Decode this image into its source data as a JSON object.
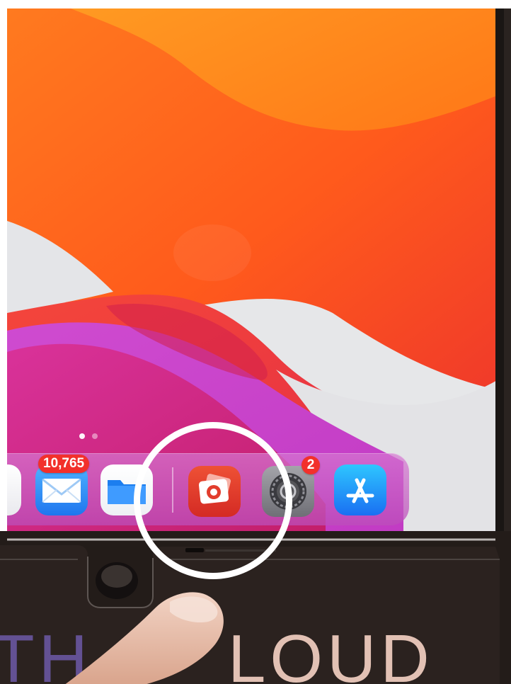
{
  "home_screen": {
    "page_indicator": {
      "pages": 2,
      "current": 1
    }
  },
  "dock": {
    "apps": [
      {
        "id": "partial-app",
        "icon": "app-icon-partial"
      },
      {
        "id": "mail",
        "icon": "envelope-icon",
        "badge": "10,765",
        "color": "#2d8ff5"
      },
      {
        "id": "files",
        "icon": "folder-icon",
        "color": "#1a82f0"
      },
      {
        "id": "photo-editor",
        "icon": "camera-photos-icon",
        "color": "#e63a2f"
      },
      {
        "id": "settings",
        "icon": "gear-icon",
        "badge": "2",
        "color": "#8e8e93"
      },
      {
        "id": "app-store",
        "icon": "app-store-icon",
        "color": "#1b8cf6"
      }
    ]
  },
  "annotation": {
    "shape": "circle",
    "color": "#ffffff",
    "target": "photo-editor"
  },
  "case": {
    "lettering_left": "TH",
    "lettering_right": "LOUD"
  },
  "colors": {
    "wallpaper_orange": "#ff6a1c",
    "wallpaper_red": "#f2353b",
    "wallpaper_pink": "#dd2f8a",
    "wallpaper_purple": "#c93fc9",
    "badge_red": "#f2302b"
  }
}
